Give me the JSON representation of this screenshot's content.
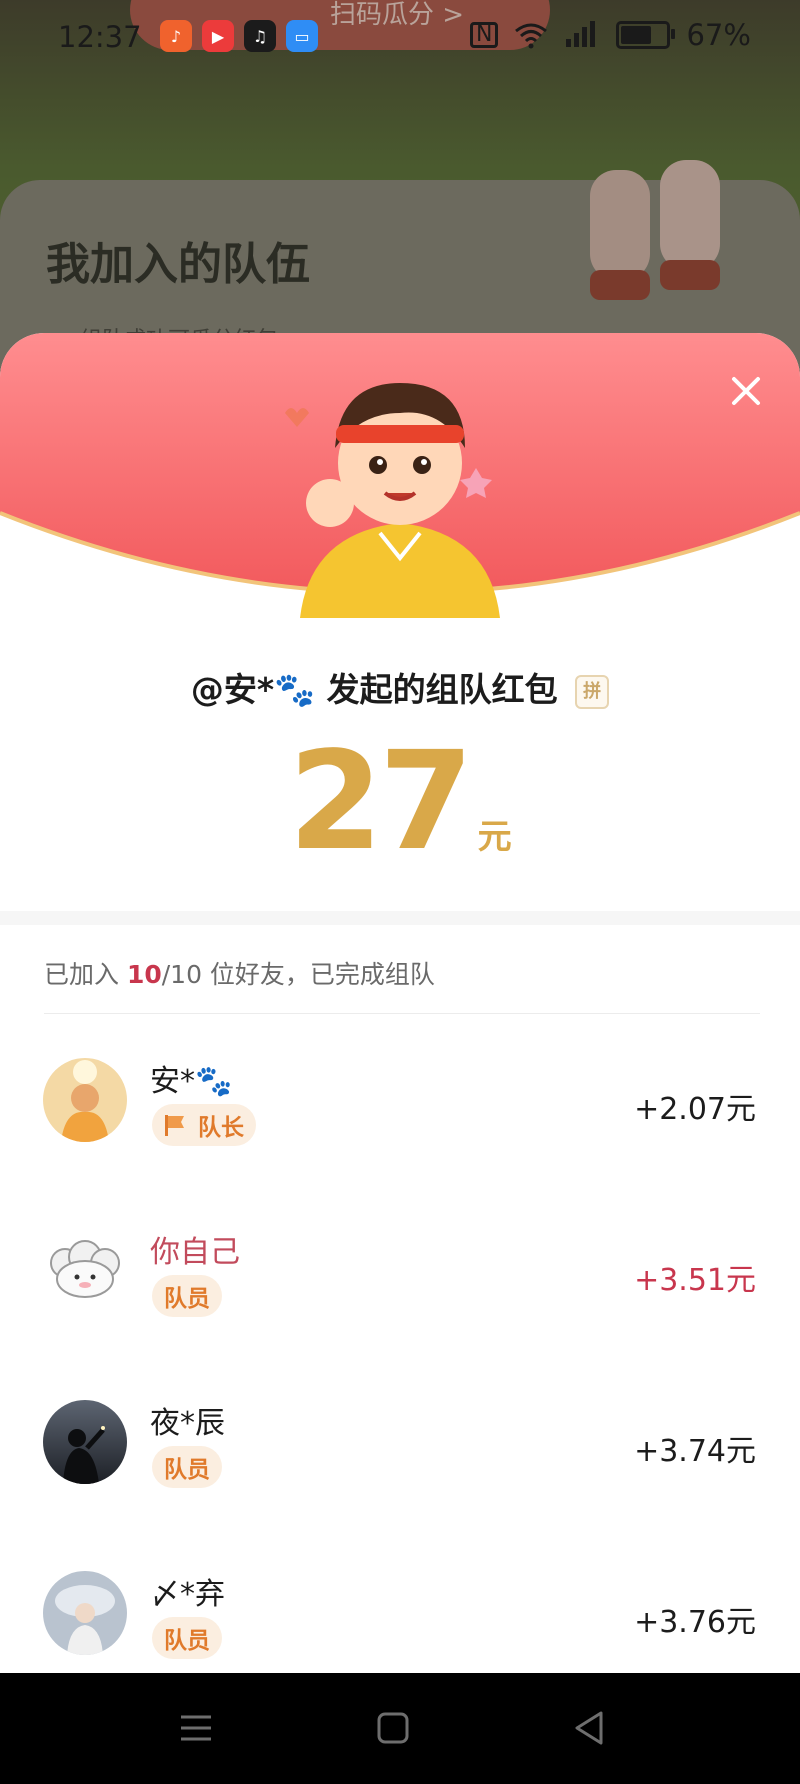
{
  "status_bar": {
    "time": "12:37",
    "battery": "67%",
    "battery_level": 0.67
  },
  "background": {
    "banner_text": "扫码瓜分 >",
    "card_title": "我加入的队伍",
    "card_subtitle": "组队成功可瓜分红包"
  },
  "sheet": {
    "headline_prefix": "@安*🐾 发起的组队红包",
    "headline_tag": "拼",
    "amount": "27",
    "amount_unit": "元",
    "summary": {
      "prefix": "已加入 ",
      "joined": "10",
      "total": "/10",
      "suffix": " 位好友，已完成组队"
    },
    "members": [
      {
        "name": "安*🐾",
        "role": "队长",
        "amount": "+2.07元",
        "is_self": false
      },
      {
        "name": "你自己",
        "role": "队员",
        "amount": "+3.51元",
        "is_self": true
      },
      {
        "name": "夜*辰",
        "role": "队员",
        "amount": "+3.74元",
        "is_self": false
      },
      {
        "name": "〆*弃",
        "role": "队员",
        "amount": "+3.76元",
        "is_self": false
      }
    ]
  },
  "colors": {
    "accent_gold": "#d9a849",
    "accent_red": "#c8364d",
    "hero_gradient_start": "#ff8d8f",
    "hero_gradient_end": "#f25a5d"
  }
}
